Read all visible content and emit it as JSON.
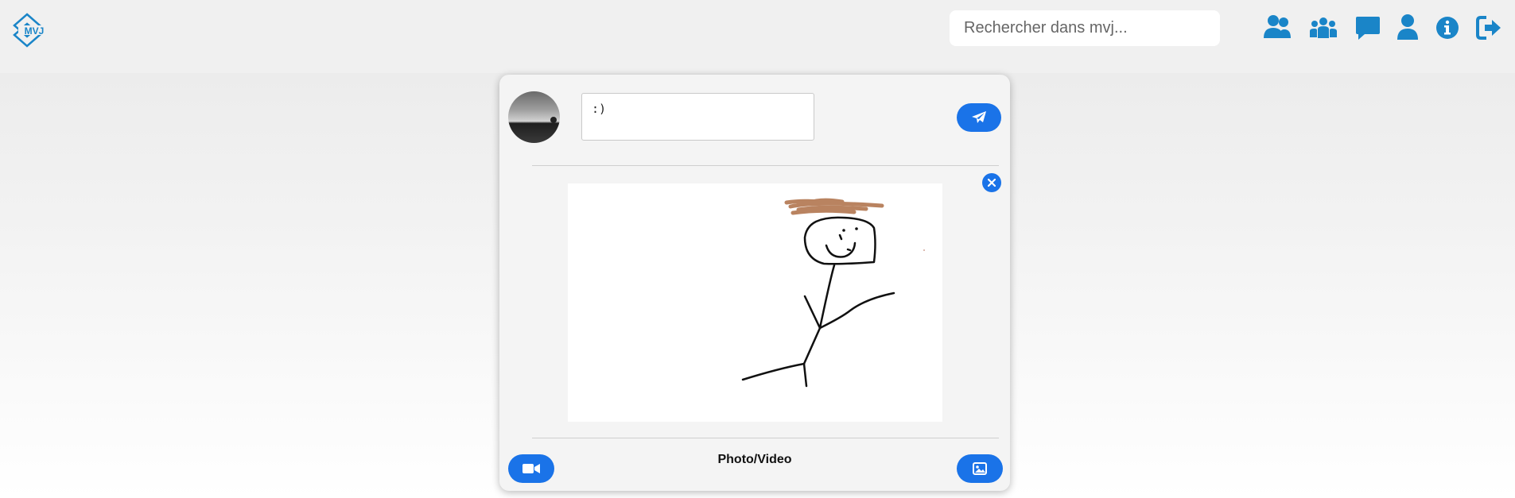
{
  "app": {
    "logo_text": "MVJ",
    "brand_color": "#1a85c8",
    "accent_color": "#1a73e8"
  },
  "search": {
    "placeholder": "Rechercher dans mvj...",
    "value": ""
  },
  "nav_icons": [
    "friends-icon",
    "groups-icon",
    "messages-icon",
    "profile-icon",
    "info-icon",
    "logout-icon"
  ],
  "composer": {
    "text": ":)",
    "send_icon": "paper-plane-icon",
    "close_icon": "close-icon",
    "attached_image": "stick-figure-drawing",
    "media_label": "Photo/Video",
    "video_icon": "video-camera-icon",
    "image_icon": "image-icon"
  }
}
